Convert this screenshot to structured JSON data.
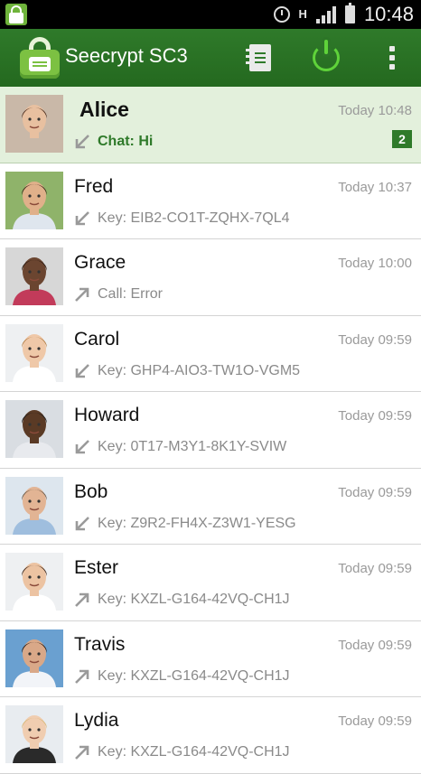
{
  "status_bar": {
    "time": "10:48",
    "network": "H"
  },
  "app": {
    "title": "Seecrypt SC3"
  },
  "contacts": [
    {
      "name": "Alice",
      "time": "Today 10:48",
      "direction": "incoming",
      "detail": "Chat: Hi",
      "unread": "2",
      "highlight": true,
      "avatar": {
        "bg": "#c9b8a8",
        "skin": "#e8c0a0",
        "hair": "#4a2a1a",
        "shirt": "#c9b8a8"
      }
    },
    {
      "name": "Fred",
      "time": "Today 10:37",
      "direction": "incoming",
      "detail": "Key: EIB2-CO1T-ZQHX-7QL4",
      "avatar": {
        "bg": "#8fb36a",
        "skin": "#e0b08a",
        "hair": "#3a2a1a",
        "shirt": "#dfe6ee"
      }
    },
    {
      "name": "Grace",
      "time": "Today 10:00",
      "direction": "outgoing",
      "detail": "Call: Error",
      "avatar": {
        "bg": "#d7d7d7",
        "skin": "#6b4530",
        "hair": "#2a1a10",
        "shirt": "#c23b5a"
      }
    },
    {
      "name": "Carol",
      "time": "Today 09:59",
      "direction": "incoming",
      "detail": "Key: GHP4-AIO3-TW1O-VGM5",
      "avatar": {
        "bg": "#eef0f2",
        "skin": "#efc8a8",
        "hair": "#b07a40",
        "shirt": "#ffffff"
      }
    },
    {
      "name": "Howard",
      "time": "Today 09:59",
      "direction": "incoming",
      "detail": "Key: 0T17-M3Y1-8K1Y-SVIW",
      "avatar": {
        "bg": "#d9dde2",
        "skin": "#5a3a25",
        "hair": "#1a1a1a",
        "shirt": "#e8eaee"
      }
    },
    {
      "name": "Bob",
      "time": "Today 09:59",
      "direction": "incoming",
      "detail": "Key: Z9R2-FH4X-Z3W1-YESG",
      "avatar": {
        "bg": "#dde6ee",
        "skin": "#e2b494",
        "hair": "#6a5a4a",
        "shirt": "#9fbede"
      }
    },
    {
      "name": "Ester",
      "time": "Today 09:59",
      "direction": "outgoing",
      "detail": "Key: KXZL-G164-42VQ-CH1J",
      "avatar": {
        "bg": "#eef0f2",
        "skin": "#ecc3a2",
        "hair": "#3a2418",
        "shirt": "#ffffff"
      }
    },
    {
      "name": "Travis",
      "time": "Today 09:59",
      "direction": "outgoing",
      "detail": "Key: KXZL-G164-42VQ-CH1J",
      "avatar": {
        "bg": "#6aa0d0",
        "skin": "#d9a888",
        "hair": "#2a1c14",
        "shirt": "#f2f4f8"
      }
    },
    {
      "name": "Lydia",
      "time": "Today 09:59",
      "direction": "outgoing",
      "detail": "Key: KXZL-G164-42VQ-CH1J",
      "avatar": {
        "bg": "#e8ecf0",
        "skin": "#f0cdb0",
        "hair": "#d8b878",
        "shirt": "#2a2a2a"
      }
    }
  ],
  "colors": {
    "accent": "#2f7a2a",
    "highlight_row": "#e3f0dc",
    "power": "#5fd33a"
  },
  "icons": {
    "contacts": "contacts-book-icon",
    "power": "power-icon",
    "menu": "overflow-menu-icon",
    "incoming": "arrow-down-left-icon",
    "outgoing": "arrow-up-right-icon"
  }
}
